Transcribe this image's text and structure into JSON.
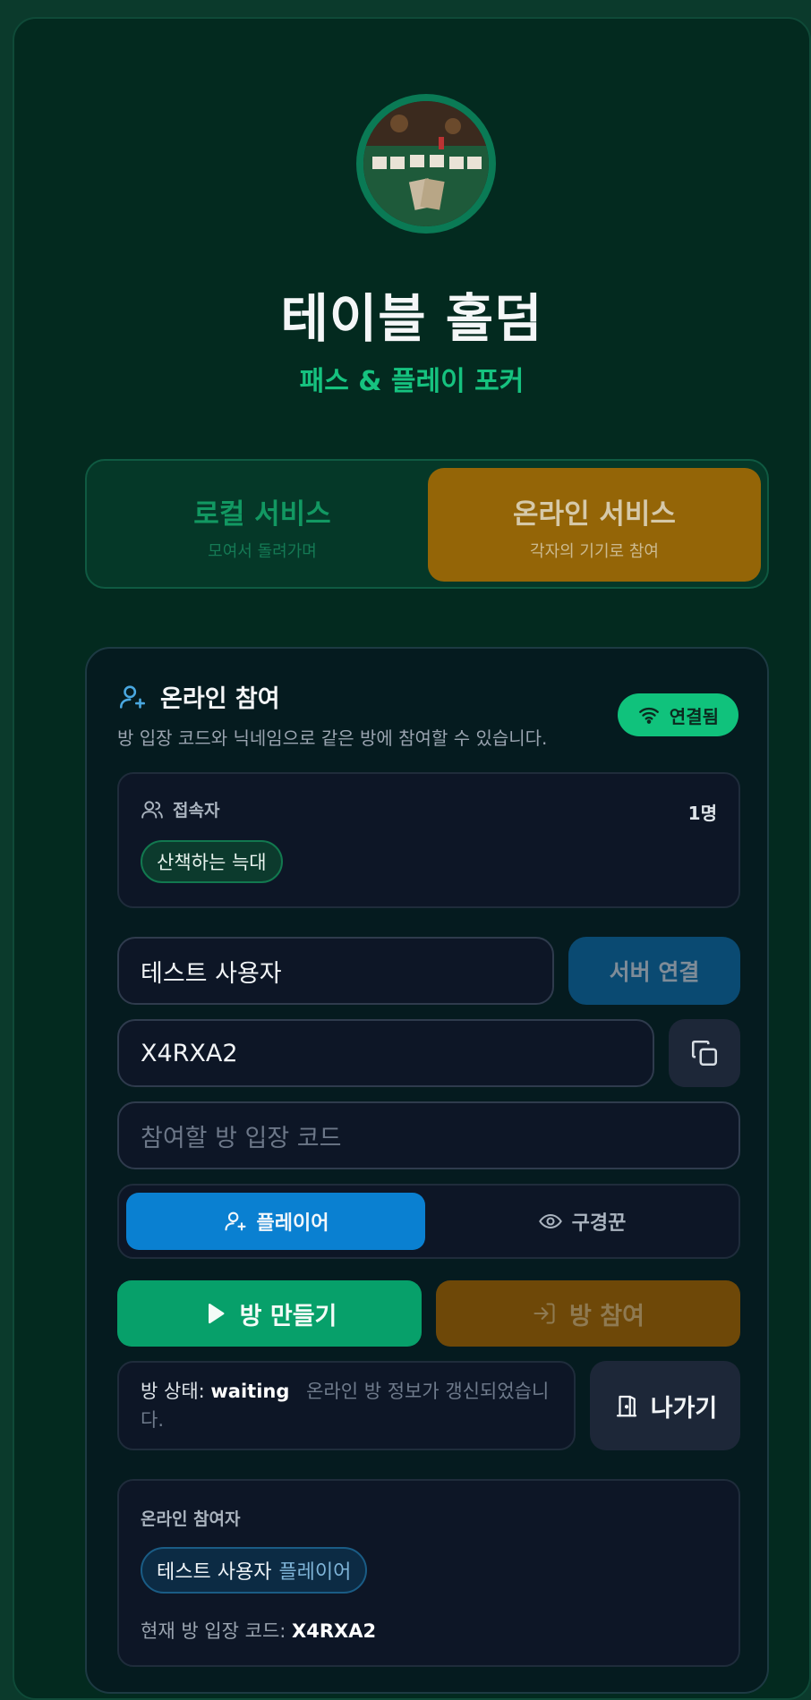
{
  "app": {
    "title": "테이블 홀덤",
    "subtitle": "패스 & 플레이 포커"
  },
  "modes": [
    {
      "label": "로컬 서비스",
      "sub": "모여서 돌려가며",
      "active": false
    },
    {
      "label": "온라인 서비스",
      "sub": "각자의 기기로 참여",
      "active": true
    }
  ],
  "online": {
    "title": "온라인 참여",
    "description": "방 입장 코드와 닉네임으로 같은 방에 참여할 수 있습니다.",
    "connection_status": "연결됨",
    "users_label": "접속자",
    "users_count": "1명",
    "users": [
      "산책하는 늑대"
    ],
    "nickname_value": "테스트 사용자",
    "connect_button": "서버 연결",
    "room_code_value": "X4RXA2",
    "join_code_placeholder": "참여할 방 입장 코드",
    "roles": [
      {
        "label": "플레이어",
        "selected": true
      },
      {
        "label": "구경꾼",
        "selected": false
      }
    ],
    "create_button": "방 만들기",
    "enter_button": "방 참여",
    "status_label": "방 상태:",
    "status_value": "waiting",
    "status_message": "온라인 방 정보가 갱신되었습니다.",
    "exit_button": "나가기",
    "participants_label": "온라인 참여자",
    "participants": [
      {
        "name": "테스트 사용자",
        "role": "플레이어"
      }
    ],
    "current_code_label": "현재 방 입장 코드:",
    "current_code_value": "X4RXA2"
  },
  "colors": {
    "accent_green": "#10c27c",
    "online_mode": "#946507",
    "player_blue": "#0a80d1",
    "create_green": "#07a06a"
  },
  "icons": [
    "poker-table-logo",
    "user-plus-icon",
    "wifi-icon",
    "users-icon",
    "copy-icon",
    "eye-icon",
    "play-icon",
    "login-icon",
    "door-exit-icon"
  ]
}
